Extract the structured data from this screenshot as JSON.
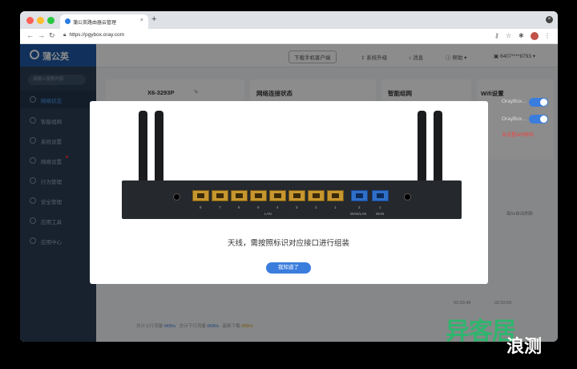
{
  "browser": {
    "tab_title": "蒲公英路由器云管理",
    "tab_close": "×",
    "new_tab": "+",
    "url": "https://pgybox.oray.com",
    "win_close": "×"
  },
  "app": {
    "brand": "蒲公英",
    "search_placeholder": "请输入搜索内容",
    "nav": [
      {
        "label": "网络状态",
        "active": true
      },
      {
        "label": "智能组网"
      },
      {
        "label": "系统设置"
      },
      {
        "label": "网络设置"
      },
      {
        "label": "行为管理"
      },
      {
        "label": "安全管理"
      },
      {
        "label": "应用工具"
      },
      {
        "label": "应用中心"
      }
    ],
    "header": {
      "download_btn": "下载手机客户端",
      "upgrade": "系统升级",
      "messages": "消息",
      "help": "帮助",
      "account": "6407****8793"
    },
    "cards": {
      "device_name": "X6-3293P",
      "network_status": "网络连接状态",
      "smart_net": "智能组网",
      "wifi": "Wifi设置"
    },
    "wifi": {
      "ssid1": "OrayBox...",
      "ssid2": "OrayBox...",
      "warn": "未设置Wifi密码"
    },
    "bg_labels": {
      "auto_refresh": "每5s自动刷新",
      "time1": "02:03:48",
      "time2": "02:03:55"
    },
    "footer": {
      "up_label": "总计上行流量",
      "up_value": "0KB/s",
      "down_label": "总计下行流量",
      "down_value": "0KB/s",
      "total_label": "最新下载",
      "total_value": "0KB/s"
    }
  },
  "modal": {
    "lan_label": "LAN",
    "wan_lan_label": "WAN/LAN",
    "wan_label": "WAN",
    "port_numbers": [
      "8",
      "7",
      "6",
      "5",
      "4",
      "3",
      "2",
      "1"
    ],
    "wan_port_numbers": [
      "2",
      "1"
    ],
    "message": "天线，需按照标识对应接口进行组装",
    "ok_button": "我知道了"
  },
  "watermark": {
    "main": "异客居",
    "sub": "浪测"
  }
}
